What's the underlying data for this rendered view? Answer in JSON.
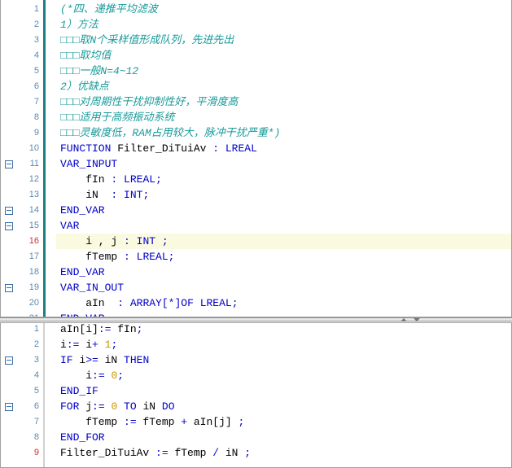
{
  "colors": {
    "keyword": "#0000c8",
    "comment": "#1a9a9a",
    "number": "#c89600",
    "current_line": "#fafae0",
    "gutter_bar": "#1a8080"
  },
  "declaration_pane": {
    "current_line": 16,
    "fold_lines": [
      11,
      14,
      15,
      19
    ],
    "lines": [
      [
        [
          "c",
          "(*四、递推平均滤波"
        ]
      ],
      [
        [
          "c",
          "1）方法"
        ]
      ],
      [
        [
          "c",
          "□□□取N个采样值形成队列，先进先出"
        ]
      ],
      [
        [
          "c",
          "□□□取均值"
        ]
      ],
      [
        [
          "c",
          "□□□一般N=4~12"
        ]
      ],
      [
        [
          "c",
          "2）优缺点"
        ]
      ],
      [
        [
          "c",
          "□□□对周期性干扰抑制性好，平滑度高"
        ]
      ],
      [
        [
          "c",
          "□□□适用于高频振动系统"
        ]
      ],
      [
        [
          "c",
          "□□□灵敏度低，RAM占用较大，脉冲干扰严重*)"
        ]
      ],
      [
        [
          "k",
          "FUNCTION"
        ],
        [
          "i",
          " Filter_DiTuiAv "
        ],
        [
          "o",
          ":"
        ],
        [
          "i",
          " "
        ],
        [
          "k",
          "LREAL"
        ]
      ],
      [
        [
          "k",
          "VAR_INPUT"
        ]
      ],
      [
        [
          "i",
          "    fIn "
        ],
        [
          "o",
          ":"
        ],
        [
          "i",
          " "
        ],
        [
          "k",
          "LREAL"
        ],
        [
          "o",
          ";"
        ]
      ],
      [
        [
          "i",
          "    iN  "
        ],
        [
          "o",
          ":"
        ],
        [
          "i",
          " "
        ],
        [
          "k",
          "INT"
        ],
        [
          "o",
          ";"
        ]
      ],
      [
        [
          "k",
          "END_VAR"
        ]
      ],
      [
        [
          "k",
          "VAR"
        ]
      ],
      [
        [
          "i",
          "    i , j "
        ],
        [
          "o",
          ":"
        ],
        [
          "i",
          " "
        ],
        [
          "k",
          "INT"
        ],
        [
          "o",
          " ;"
        ]
      ],
      [
        [
          "i",
          "    fTemp "
        ],
        [
          "o",
          ":"
        ],
        [
          "i",
          " "
        ],
        [
          "k",
          "LREAL"
        ],
        [
          "o",
          ";"
        ]
      ],
      [
        [
          "k",
          "END_VAR"
        ]
      ],
      [
        [
          "k",
          "VAR_IN_OUT"
        ]
      ],
      [
        [
          "i",
          "    aIn  "
        ],
        [
          "o",
          ":"
        ],
        [
          "i",
          " "
        ],
        [
          "k",
          "ARRAY"
        ],
        [
          "o",
          "[*]"
        ],
        [
          "k",
          "OF"
        ],
        [
          "i",
          " "
        ],
        [
          "k",
          "LREAL"
        ],
        [
          "o",
          ";"
        ]
      ],
      [
        [
          "k",
          "END_VAR"
        ]
      ]
    ]
  },
  "implementation_pane": {
    "current_line": 9,
    "fold_lines": [
      3,
      6
    ],
    "lines": [
      [
        [
          "i",
          "aIn[i]"
        ],
        [
          "o",
          ":="
        ],
        [
          "i",
          " fIn"
        ],
        [
          "o",
          ";"
        ]
      ],
      [
        [
          "i",
          "i"
        ],
        [
          "o",
          ":="
        ],
        [
          "i",
          " i"
        ],
        [
          "o",
          "+"
        ],
        [
          "i",
          " "
        ],
        [
          "n",
          "1"
        ],
        [
          "o",
          ";"
        ]
      ],
      [
        [
          "k",
          "IF"
        ],
        [
          "i",
          " i"
        ],
        [
          "o",
          ">="
        ],
        [
          "i",
          " iN "
        ],
        [
          "k",
          "THEN"
        ]
      ],
      [
        [
          "i",
          "    i"
        ],
        [
          "o",
          ":="
        ],
        [
          "i",
          " "
        ],
        [
          "n",
          "0"
        ],
        [
          "o",
          ";"
        ]
      ],
      [
        [
          "k",
          "END_IF"
        ]
      ],
      [
        [
          "k",
          "FOR"
        ],
        [
          "i",
          " j"
        ],
        [
          "o",
          ":="
        ],
        [
          "i",
          " "
        ],
        [
          "n",
          "0"
        ],
        [
          "i",
          " "
        ],
        [
          "k",
          "TO"
        ],
        [
          "i",
          " iN "
        ],
        [
          "k",
          "DO"
        ]
      ],
      [
        [
          "i",
          "    fTemp "
        ],
        [
          "o",
          ":="
        ],
        [
          "i",
          " fTemp "
        ],
        [
          "o",
          "+"
        ],
        [
          "i",
          " aIn[j] "
        ],
        [
          "o",
          ";"
        ]
      ],
      [
        [
          "k",
          "END_FOR"
        ]
      ],
      [
        [
          "i",
          "Filter_DiTuiAv "
        ],
        [
          "o",
          ":="
        ],
        [
          "i",
          " fTemp "
        ],
        [
          "o",
          "/"
        ],
        [
          "i",
          " iN "
        ],
        [
          "o",
          ";"
        ]
      ]
    ]
  }
}
